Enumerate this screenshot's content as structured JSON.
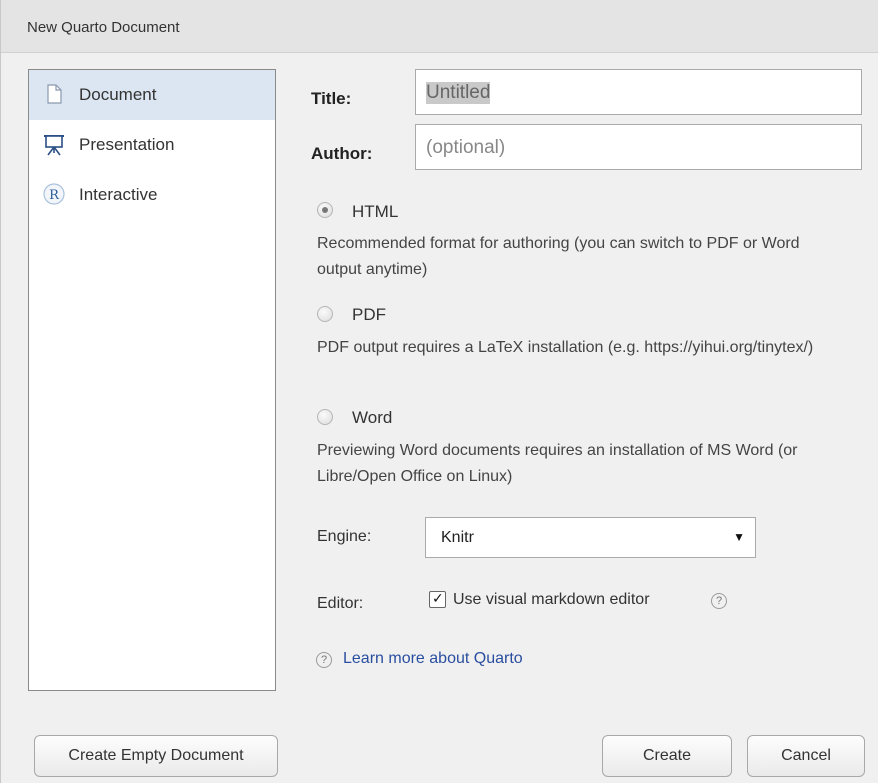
{
  "window": {
    "title": "New Quarto Document"
  },
  "sidebar": {
    "items": [
      {
        "label": "Document",
        "icon": "document-icon",
        "selected": true
      },
      {
        "label": "Presentation",
        "icon": "presentation-icon",
        "selected": false
      },
      {
        "label": "Interactive",
        "icon": "r-icon",
        "selected": false
      }
    ]
  },
  "form": {
    "title_label": "Title:",
    "title_value": "Untitled",
    "author_label": "Author:",
    "author_placeholder": "(optional)",
    "formats": [
      {
        "label": "HTML",
        "checked": true,
        "description": "Recommended format for authoring (you can switch to PDF or Word output anytime)"
      },
      {
        "label": "PDF",
        "checked": false,
        "description": "PDF output requires a LaTeX installation (e.g. https://yihui.org/tinytex/)"
      },
      {
        "label": "Word",
        "checked": false,
        "description": "Previewing Word documents requires an installation of MS Word (or Libre/Open Office on Linux)"
      }
    ],
    "engine_label": "Engine:",
    "engine_value": "Knitr",
    "editor_label": "Editor:",
    "visual_editor_label": "Use visual markdown editor",
    "visual_editor_checked": true,
    "help_glyph": "?",
    "learn_more": "Learn more about Quarto"
  },
  "buttons": {
    "create_empty": "Create Empty Document",
    "create": "Create",
    "cancel": "Cancel"
  },
  "colors": {
    "selection": "#dce6f2",
    "link": "#2a4ea0",
    "title_highlight": "#c9c9c9"
  }
}
